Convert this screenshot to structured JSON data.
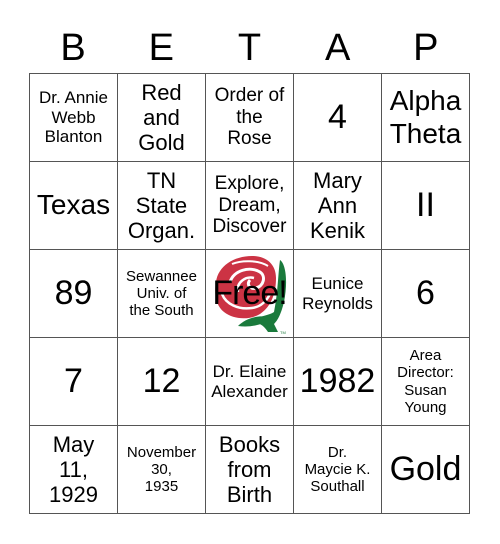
{
  "header": {
    "letters": [
      "B",
      "E",
      "T",
      "A",
      "P"
    ]
  },
  "colors": {
    "rose_red": "#cc3344",
    "rose_green": "#1a7a3c",
    "grid_line": "#555555"
  },
  "cells": [
    [
      "Dr. Annie\nWebb\nBlanton",
      "Red\nand\nGold",
      "Order of\nthe\nRose",
      "4",
      "Alpha\nTheta"
    ],
    [
      "Texas",
      "TN\nState\nOrgan.",
      "Explore,\nDream,\nDiscover",
      "Mary\nAnn\nKenik",
      "II"
    ],
    [
      "89",
      "Sewannee\nUniv. of\nthe South",
      "Free!",
      "Eunice\nReynolds",
      "6"
    ],
    [
      "7",
      "12",
      "Dr. Elaine\nAlexander",
      "1982",
      "Area\nDirector:\nSusan\nYoung"
    ],
    [
      "May\n11,\n1929",
      "November\n30,\n1935",
      "Books\nfrom\nBirth",
      "Dr.\nMaycie K.\nSouthall",
      "Gold"
    ]
  ],
  "free_space": {
    "label": "Free!",
    "image": "rose-logo",
    "trademark": "TM"
  }
}
